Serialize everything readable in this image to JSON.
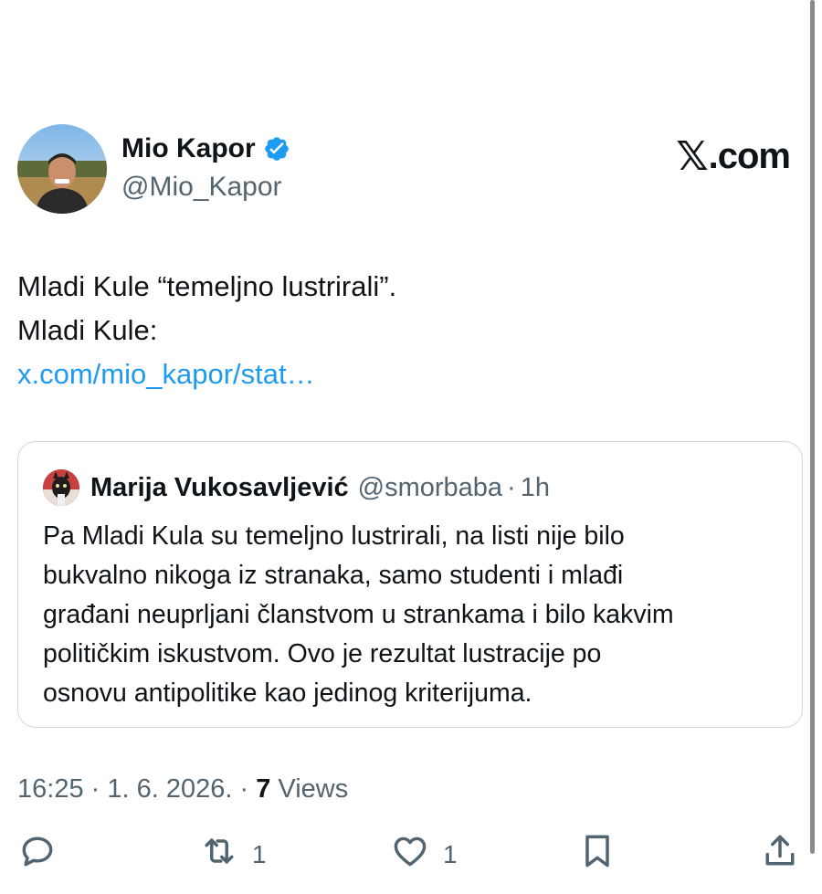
{
  "author": {
    "name": "Mio Kapor",
    "handle": "@Mio_Kapor",
    "verified": true
  },
  "site_logo": {
    "mark": "𝕏",
    "text": ".com"
  },
  "tweet": {
    "lines": [
      "Mladi Kule “temeljno lustrirali”.",
      "Mladi Kule:"
    ],
    "link": "x.com/mio_kapor/stat…"
  },
  "quote": {
    "name": "Marija Vukosavljević",
    "handle": "@smorbaba",
    "separator": "·",
    "time": "1h",
    "lines": [
      "Pa Mladi Kula su temeljno lustrirali, na listi nije bilo",
      "bukvalno nikoga iz stranaka, samo studenti i mlađi",
      "građani neuprljani članstvom u strankama i bilo kakvim",
      "političkim iskustvom. Ovo je rezultat lustracije po",
      "osnovu antipolitike kao jedinog kriterijuma."
    ]
  },
  "meta": {
    "time": "16:25",
    "sep1": " · ",
    "date": "1. 6. 2026.",
    "sep2": " · ",
    "views_count": "7",
    "views_label": " Views"
  },
  "actions": {
    "reply": {
      "icon": "reply-icon",
      "count": ""
    },
    "retweet": {
      "icon": "retweet-icon",
      "count": "1"
    },
    "like": {
      "icon": "heart-icon",
      "count": "1"
    },
    "bookmark": {
      "icon": "bookmark-icon",
      "count": ""
    },
    "share": {
      "icon": "share-icon",
      "count": ""
    }
  },
  "colors": {
    "link": "#1d9bf0",
    "secondary_text": "#536471",
    "verified": "#1d9bf0"
  }
}
